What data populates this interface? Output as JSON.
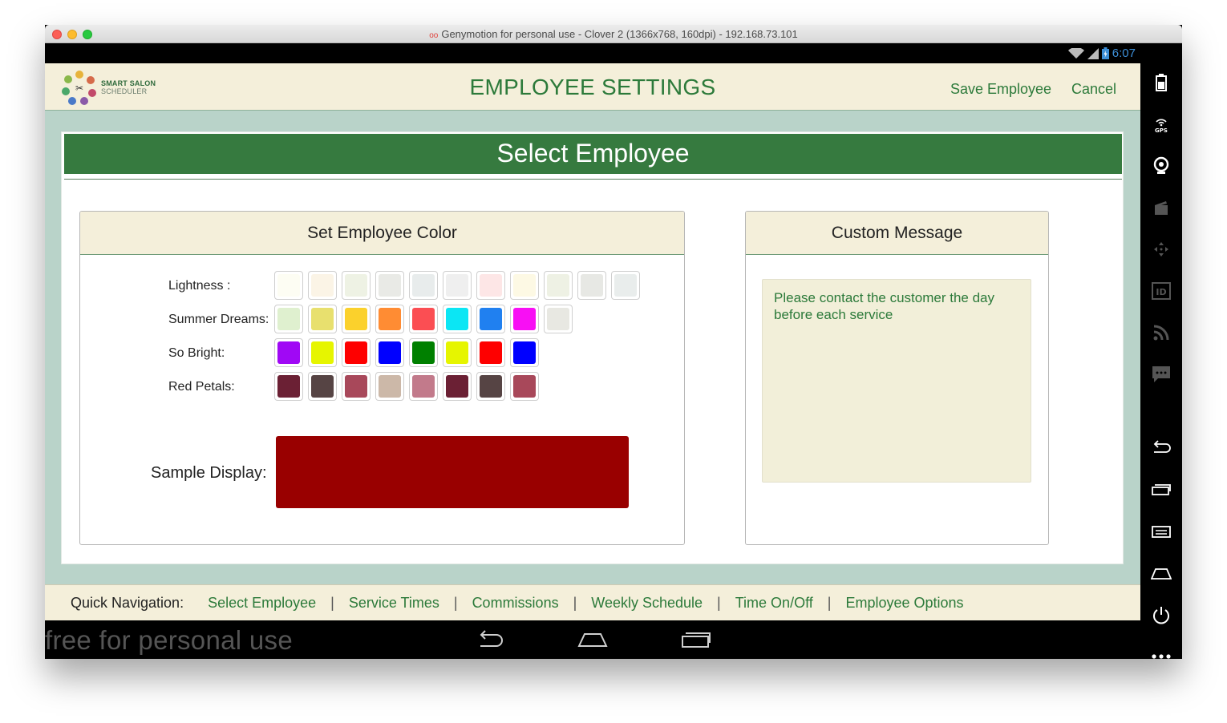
{
  "window": {
    "title": "Genymotion for personal use - Clover 2 (1366x768, 160dpi) - 192.168.73.101"
  },
  "statusbar": {
    "time": "6:07"
  },
  "header": {
    "logo_line1": "SMART SALON",
    "logo_line2": "SCHEDULER",
    "title": "EMPLOYEE SETTINGS",
    "save_label": "Save Employee",
    "cancel_label": "Cancel"
  },
  "section": {
    "title": "Select Employee"
  },
  "color_panel": {
    "title": "Set Employee Color",
    "palettes": [
      {
        "label": "Lightness :",
        "colors": [
          "#fdfdf3",
          "#fbf4e6",
          "#eef2e4",
          "#e9eae6",
          "#e8ecec",
          "#efefef",
          "#fde6e6",
          "#fdf9e4",
          "#eef1e4",
          "#e7e8e4",
          "#e9edec"
        ]
      },
      {
        "label": "Summer Dreams:",
        "colors": [
          "#dff0cf",
          "#e8e06e",
          "#fbd12c",
          "#ff8c33",
          "#fb4e53",
          "#0be6f4",
          "#2080f0",
          "#f80ff4",
          "#e8e8e2"
        ]
      },
      {
        "label": "So Bright:",
        "colors": [
          "#a008f5",
          "#e6f500",
          "#fe0000",
          "#0000ff",
          "#008000",
          "#e6f500",
          "#fe0000",
          "#0000ff"
        ]
      },
      {
        "label": "Red Petals:",
        "colors": [
          "#6b2034",
          "#564444",
          "#a8485a",
          "#ccb8a8",
          "#c27a8b",
          "#6b2034",
          "#564444",
          "#a8485a"
        ]
      }
    ],
    "sample_label": "Sample Display:",
    "sample_color": "#990000"
  },
  "message_panel": {
    "title": "Custom Message",
    "text": "Please contact the customer the day before each service"
  },
  "quick_nav": {
    "label": "Quick Navigation:",
    "links": [
      "Select Employee",
      "Service Times",
      "Commissions",
      "Weekly Schedule",
      "Time On/Off",
      "Employee Options"
    ]
  },
  "navbar": {
    "watermark": "free for personal use"
  },
  "toolbar": {
    "items": [
      "battery-icon",
      "gps-icon",
      "webcam-icon",
      "screencast-icon",
      "dpad-icon",
      "device-id-icon",
      "rss-icon",
      "sms-icon",
      "back-icon",
      "recent-apps-icon",
      "menu-icon",
      "home-icon",
      "power-icon",
      "more-icon"
    ]
  }
}
